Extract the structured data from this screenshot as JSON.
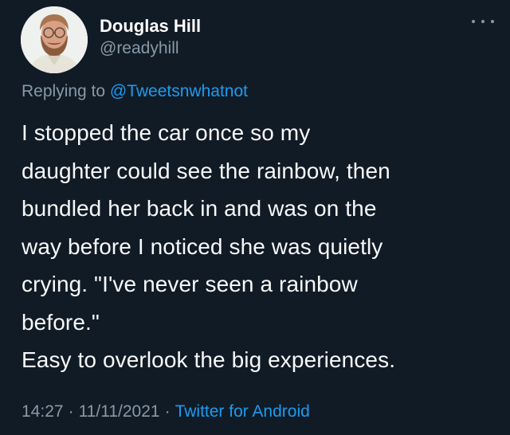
{
  "author": {
    "display_name": "Douglas Hill",
    "handle": "@readyhill"
  },
  "reply": {
    "prefix": "Replying to ",
    "mention": "@Tweetsnwhatnot"
  },
  "tweet": {
    "lines": [
      "I stopped the car once so my",
      "daughter could see the rainbow, then",
      "bundled her back in and was on the",
      "way before I noticed she was quietly",
      "crying. \"I've never seen a rainbow",
      "before.\"",
      "Easy to overlook the big experiences."
    ]
  },
  "footer": {
    "time": "14:27",
    "date": "11/11/2021",
    "separator": "·",
    "source": "Twitter for Android"
  },
  "icons": {
    "more": "more-options-icon",
    "avatar": "profile-avatar"
  },
  "colors": {
    "background": "#111b26",
    "text": "#f7f9f9",
    "muted": "#8899a6",
    "accent": "#1d9bf0"
  }
}
